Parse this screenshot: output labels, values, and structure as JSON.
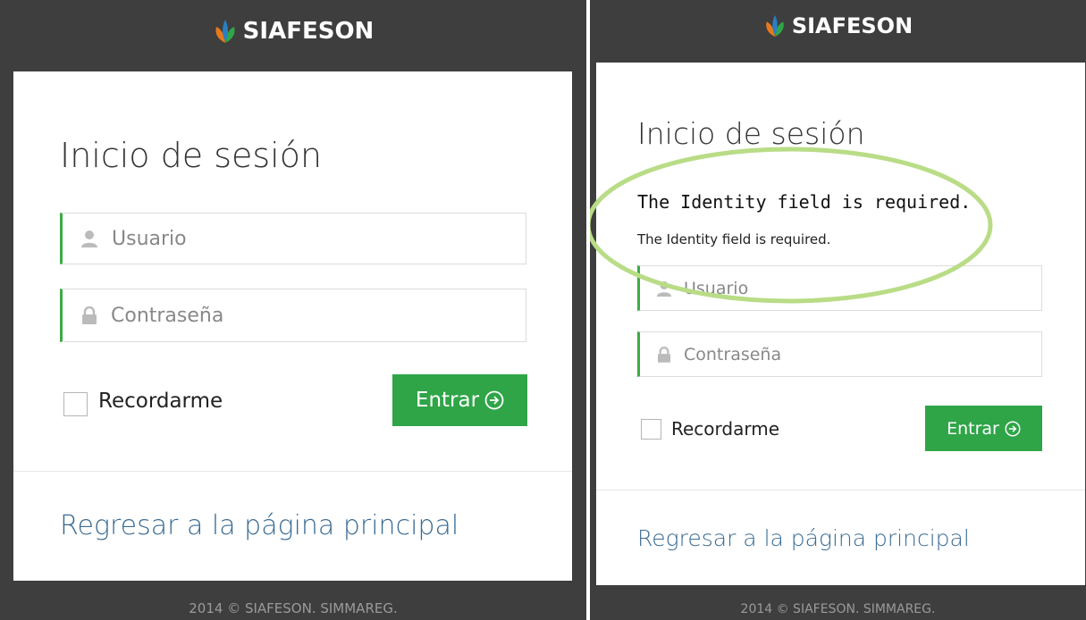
{
  "brand": {
    "name": "SIAFESON"
  },
  "colors": {
    "accent": "#2fa548",
    "link": "#3a6b93",
    "annotation": "#b9dc86",
    "header_bg": "#3e3e3e"
  },
  "login": {
    "title": "Inicio de sesión",
    "username_placeholder": "Usuario",
    "password_placeholder": "Contraseña",
    "remember_label": "Recordarme",
    "submit_label": "Entrar",
    "back_link": "Regresar a la página principal"
  },
  "errors": {
    "summary": "The Identity field is required.",
    "detail": "The Identity field is required."
  },
  "footer": {
    "text": "2014 © SIAFESON. SIMMAREG."
  },
  "icons": {
    "user": "user-icon",
    "lock": "lock-icon",
    "submit": "arrow-circle-right-icon",
    "logo": "leaf-logo-icon"
  }
}
